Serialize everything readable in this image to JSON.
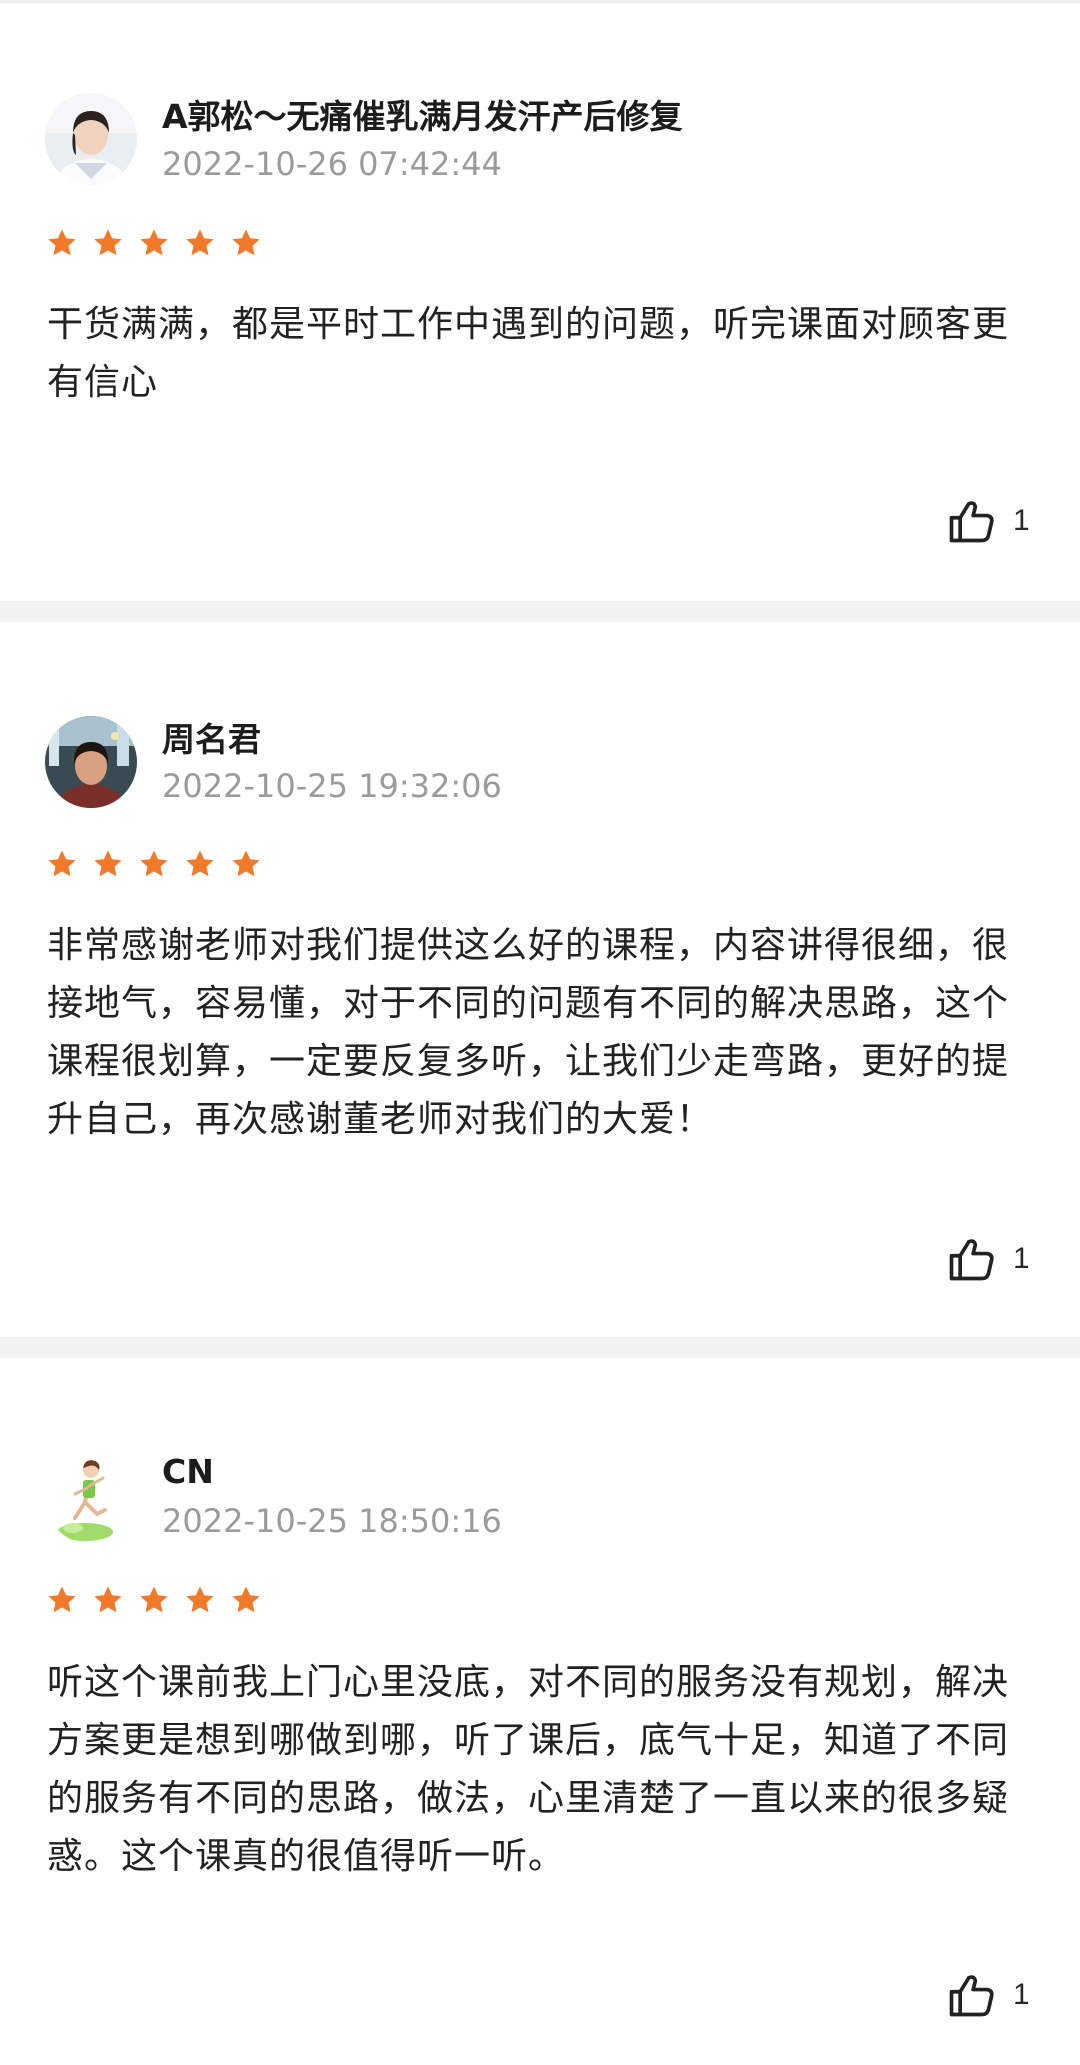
{
  "colors": {
    "star": "#F07A2A",
    "name": "#1C1C1C",
    "time": "#9B9B9B",
    "divider": "#F2F2F2"
  },
  "reviews": [
    {
      "user": "A郭松～无痛催乳满月发汗产后修复",
      "time": "2022-10-26 07:42:44",
      "rating": 5,
      "content": "干货满满，都是平时工作中遇到的问题，听完课面对顾客更有信心",
      "likes": "1",
      "like_icon": "thumbs-up-icon",
      "avatar_icon": "avatar-woman-white-coat"
    },
    {
      "user": "周名君",
      "time": "2022-10-25 19:32:06",
      "rating": 5,
      "content": "非常感谢老师对我们提供这么好的课程，内容讲得很细，很接地气，容易懂，对于不同的问题有不同的解决思路，这个课程很划算，一定要反复多听，让我们少走弯路，更好的提升自己，再次感谢董老师对我们的大爱！",
      "likes": "1",
      "like_icon": "thumbs-up-icon",
      "avatar_icon": "avatar-woman-night-street"
    },
    {
      "user": "CN",
      "time": "2022-10-25 18:50:16",
      "rating": 5,
      "content": "听这个课前我上门心里没底，对不同的服务没有规划，解决方案更是想到哪做到哪，听了课后，底气十足，知道了不同的服务有不同的思路，做法，心里清楚了一直以来的很多疑惑。这个课真的很值得听一听。",
      "likes": "1",
      "like_icon": "thumbs-up-icon",
      "avatar_icon": "avatar-cartoon-runner"
    }
  ]
}
